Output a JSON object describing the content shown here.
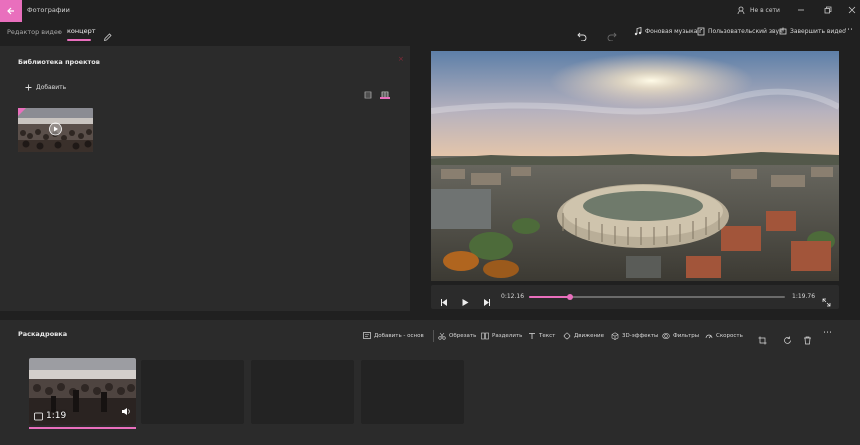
{
  "titlebar": {
    "app_title": "Фотографии",
    "offline_label": "Не в сети"
  },
  "navbar": {
    "crumb_parent": "Редактор видео",
    "crumb_current": "концерт",
    "bg_music": "Фоновая музыка",
    "custom_audio": "Пользовательский звук",
    "finish_video": "Завершить видео"
  },
  "library": {
    "title": "Библиотека проектов",
    "add_label": "Добавить"
  },
  "player": {
    "current_time": "0:12.16",
    "total_time": "1:19.76",
    "progress": 0.16
  },
  "storyboard": {
    "title": "Раскадровка",
    "tools": {
      "add_title": "Добавить - основ",
      "trim": "Обрезать",
      "split": "Разделить",
      "text": "Текст",
      "motion": "Движение",
      "effects3d": "3D-эффекты",
      "filters": "Фильтры",
      "speed": "Скорость"
    },
    "clip_duration": "1:19"
  },
  "colors": {
    "accent": "#e96fbd",
    "background": "#202020",
    "panel": "#2b2b2b"
  }
}
